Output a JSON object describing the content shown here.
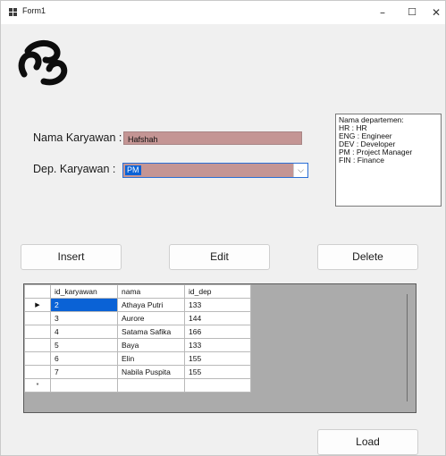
{
  "window": {
    "title": "Form1",
    "minimize_glyph": "–",
    "maximize_glyph": "☐",
    "close_glyph": "✕"
  },
  "logo": {
    "icon": "swirl-logo-icon"
  },
  "form": {
    "nama_label": "Nama Karyawan :",
    "nama_value": "Hafshah",
    "dep_label": "Dep. Karyawan :",
    "dep_value": "PM",
    "dep_arrow": "⌵"
  },
  "info": {
    "lines": [
      "Nama departemen:",
      "HR : HR",
      "ENG : Engineer",
      "DEV : Developer",
      "PM : Project Manager",
      "FIN : Finance"
    ]
  },
  "buttons": {
    "insert": "Insert",
    "edit": "Edit",
    "delete": "Delete",
    "load": "Load"
  },
  "grid": {
    "columns": [
      "id_karyawan",
      "nama",
      "id_dep"
    ],
    "rows": [
      [
        "2",
        "Athaya Putri",
        "133"
      ],
      [
        "3",
        "Aurore",
        "144"
      ],
      [
        "4",
        "Satama Safika",
        "166"
      ],
      [
        "5",
        "Baya",
        "133"
      ],
      [
        "6",
        "Elin",
        "155"
      ],
      [
        "7",
        "Nabila Puspita",
        "155"
      ]
    ],
    "current_row_marker": "▶",
    "new_row_marker": "*"
  },
  "colors": {
    "input_bg": "#c49594",
    "selection": "#0a62d6",
    "grid_bg": "#ababab"
  }
}
